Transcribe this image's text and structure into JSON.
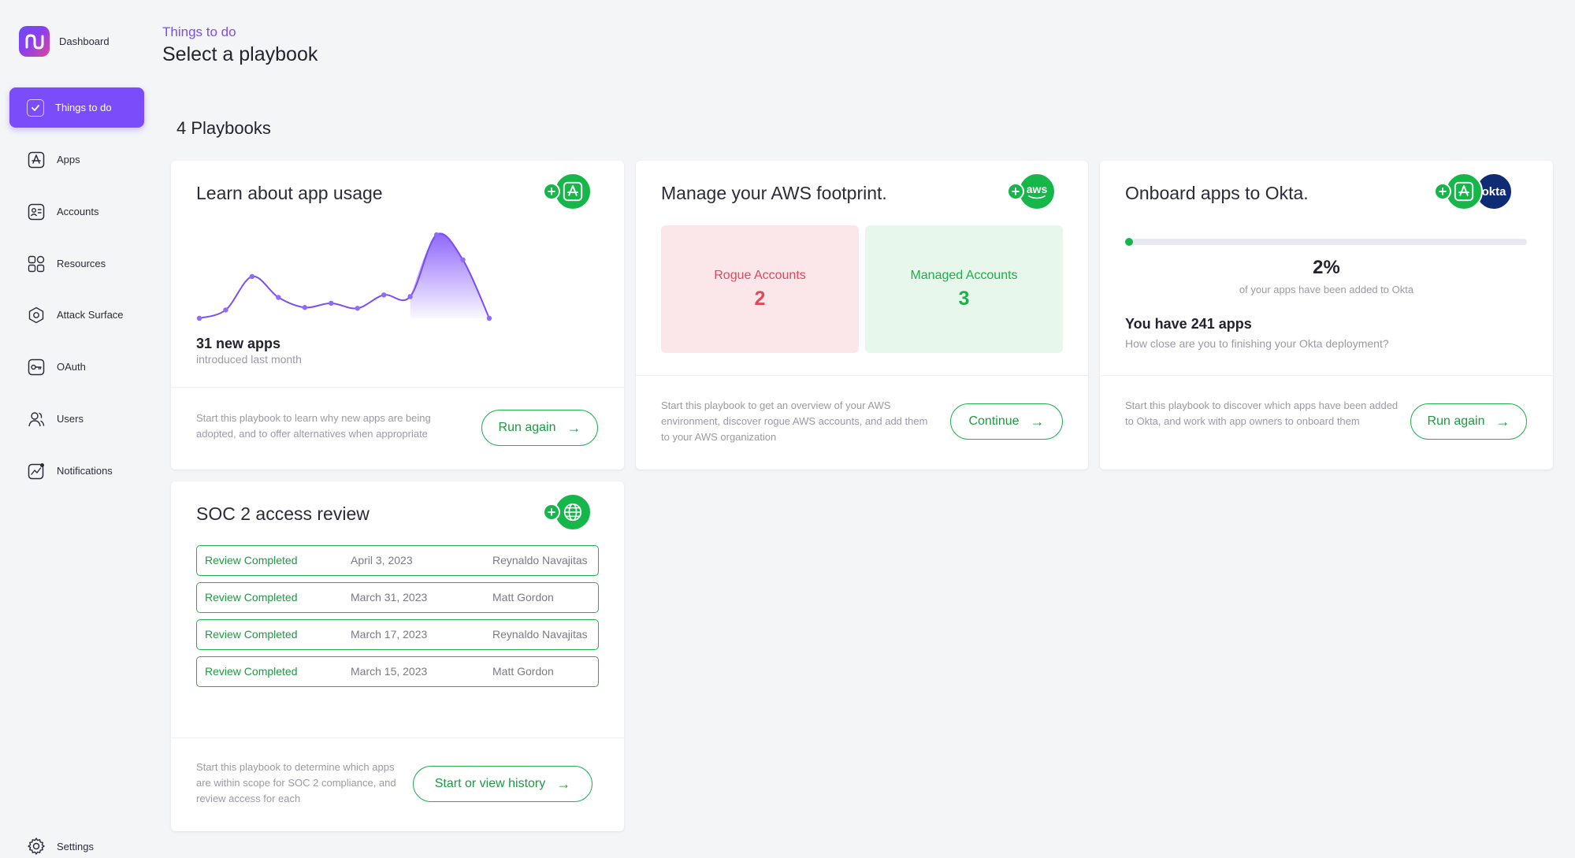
{
  "sidebar": {
    "brand_label": "Dashboard",
    "items": [
      {
        "label": "Things to do",
        "icon": "checkbox-icon",
        "active": true
      },
      {
        "label": "Apps",
        "icon": "app-store-icon"
      },
      {
        "label": "Accounts",
        "icon": "id-card-icon"
      },
      {
        "label": "Resources",
        "icon": "grid-icon"
      },
      {
        "label": "Attack Surface",
        "icon": "hexagon-target-icon"
      },
      {
        "label": "OAuth",
        "icon": "key-icon"
      },
      {
        "label": "Users",
        "icon": "users-icon"
      },
      {
        "label": "Notifications",
        "icon": "chart-bell-icon"
      }
    ],
    "settings_label": "Settings"
  },
  "header": {
    "eyebrow": "Things to do",
    "title": "Select a playbook"
  },
  "playbook_count": "4 Playbooks",
  "cards": {
    "app_usage": {
      "title": "Learn about app usage",
      "stat": "31 new apps",
      "stat_sub": "introduced last month",
      "description": "Start this playbook to learn why new apps are being adopted, and to offer alternatives when appropriate",
      "button": "Run again"
    },
    "aws": {
      "title": "Manage your AWS footprint.",
      "badge_text": "aws",
      "rogue_label": "Rogue Accounts",
      "rogue_value": "2",
      "managed_label": "Managed Accounts",
      "managed_value": "3",
      "description": "Start this playbook to get an overview of your AWS environment, discover rogue AWS accounts, and add them to your AWS organization",
      "button": "Continue"
    },
    "okta": {
      "title": "Onboard apps to Okta.",
      "badge_text": "okta",
      "progress_percent": 2,
      "percent_label": "2%",
      "percent_sub": "of your apps have been added to Okta",
      "apps_count": "You have 241 apps",
      "apps_sub": "How close are you to finishing your Okta deployment?",
      "description": "Start this playbook to discover which apps have been added to Okta, and work with app owners to onboard them",
      "button": "Run again"
    },
    "soc2": {
      "title": "SOC 2 access review",
      "reviews": [
        {
          "status": "Review Completed",
          "date": "April 3, 2023",
          "name": "Reynaldo Navajitas"
        },
        {
          "status": "Review Completed",
          "date": "March 31, 2023",
          "name": "Matt Gordon"
        },
        {
          "status": "Review Completed",
          "date": "March 17, 2023",
          "name": "Reynaldo Navajitas"
        },
        {
          "status": "Review Completed",
          "date": "March 15, 2023",
          "name": "Matt Gordon"
        }
      ],
      "description": "Start this playbook to determine which apps are within scope for SOC 2 compliance, and review access for each",
      "button": "Start or view history"
    }
  },
  "colors": {
    "accent": "#7b4dfa",
    "success": "#16b64b",
    "danger": "#e0485c",
    "okta_navy": "#0f2b74"
  },
  "chart_data": {
    "type": "area",
    "series": [
      {
        "values": [
          0,
          1,
          5,
          2.5,
          1.3,
          1.8,
          1.2,
          2.8,
          2.6,
          10,
          7,
          0
        ]
      }
    ]
  }
}
